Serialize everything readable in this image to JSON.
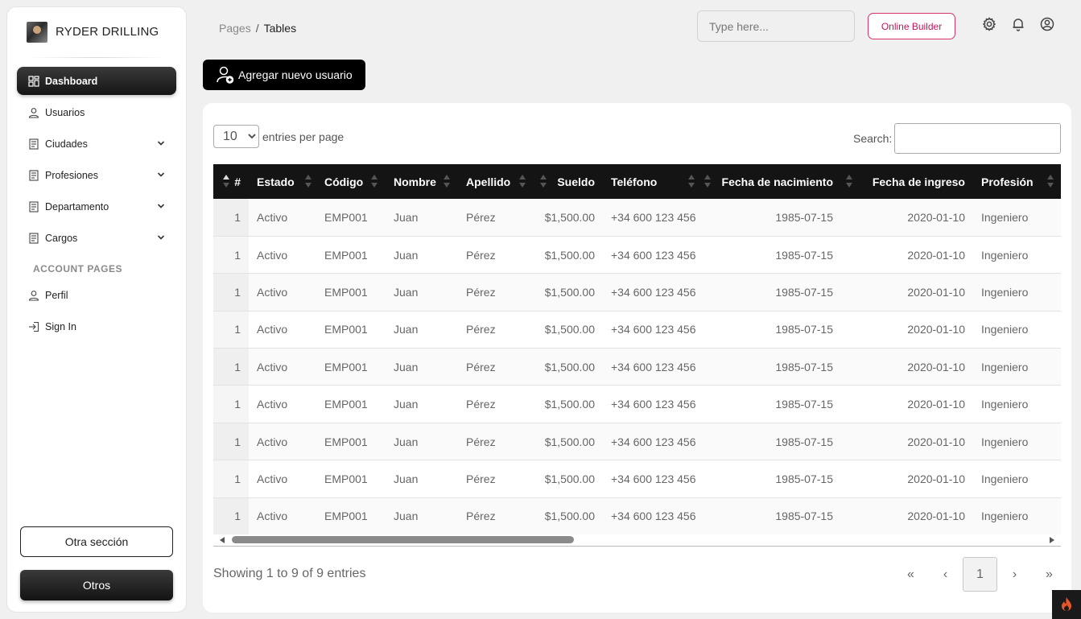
{
  "brand": {
    "name": "RYDER DRILLING"
  },
  "sidebar": {
    "items": [
      {
        "label": "Dashboard",
        "icon": "dashboard-icon",
        "active": true
      },
      {
        "label": "Usuarios",
        "icon": "user-icon"
      },
      {
        "label": "Ciudades",
        "icon": "document-icon",
        "expandable": true
      },
      {
        "label": "Profesiones",
        "icon": "document-icon",
        "expandable": true
      },
      {
        "label": "Departamento",
        "icon": "document-icon",
        "expandable": true
      },
      {
        "label": "Cargos",
        "icon": "document-icon",
        "expandable": true
      }
    ],
    "section_title": "ACCOUNT PAGES",
    "account_items": [
      {
        "label": "Perfil",
        "icon": "user-icon"
      },
      {
        "label": "Sign In",
        "icon": "sign-in-icon"
      }
    ],
    "buttons": {
      "otra_seccion": "Otra sección",
      "otros": "Otros"
    }
  },
  "header": {
    "breadcrumb": {
      "parent": "Pages",
      "separator": "/",
      "current": "Tables"
    },
    "search_placeholder": "Type here...",
    "builder_button": "Online Builder",
    "icons": [
      "gear-icon",
      "bell-icon",
      "account-circle-icon"
    ]
  },
  "add_user_button": "Agregar nuevo usuario",
  "table": {
    "page_size": "10",
    "page_size_options": [
      "10"
    ],
    "entries_label": "entries per page",
    "search_label": "Search:",
    "search_value": "",
    "columns": [
      "#",
      "Estado",
      "Código",
      "Nombre",
      "Apellido",
      "Sueldo",
      "Teléfono",
      "Fecha de nacimiento",
      "Fecha de ingreso",
      "Profesión"
    ],
    "rows": [
      [
        "1",
        "Activo",
        "EMP001",
        "Juan",
        "Pérez",
        "$1,500.00",
        "+34 600 123 456",
        "1985-07-15",
        "2020-01-10",
        "Ingeniero"
      ],
      [
        "1",
        "Activo",
        "EMP001",
        "Juan",
        "Pérez",
        "$1,500.00",
        "+34 600 123 456",
        "1985-07-15",
        "2020-01-10",
        "Ingeniero"
      ],
      [
        "1",
        "Activo",
        "EMP001",
        "Juan",
        "Pérez",
        "$1,500.00",
        "+34 600 123 456",
        "1985-07-15",
        "2020-01-10",
        "Ingeniero"
      ],
      [
        "1",
        "Activo",
        "EMP001",
        "Juan",
        "Pérez",
        "$1,500.00",
        "+34 600 123 456",
        "1985-07-15",
        "2020-01-10",
        "Ingeniero"
      ],
      [
        "1",
        "Activo",
        "EMP001",
        "Juan",
        "Pérez",
        "$1,500.00",
        "+34 600 123 456",
        "1985-07-15",
        "2020-01-10",
        "Ingeniero"
      ],
      [
        "1",
        "Activo",
        "EMP001",
        "Juan",
        "Pérez",
        "$1,500.00",
        "+34 600 123 456",
        "1985-07-15",
        "2020-01-10",
        "Ingeniero"
      ],
      [
        "1",
        "Activo",
        "EMP001",
        "Juan",
        "Pérez",
        "$1,500.00",
        "+34 600 123 456",
        "1985-07-15",
        "2020-01-10",
        "Ingeniero"
      ],
      [
        "1",
        "Activo",
        "EMP001",
        "Juan",
        "Pérez",
        "$1,500.00",
        "+34 600 123 456",
        "1985-07-15",
        "2020-01-10",
        "Ingeniero"
      ],
      [
        "1",
        "Activo",
        "EMP001",
        "Juan",
        "Pérez",
        "$1,500.00",
        "+34 600 123 456",
        "1985-07-15",
        "2020-01-10",
        "Ingeniero"
      ]
    ],
    "footer_info": "Showing 1 to 9 of 9 entries",
    "pagination": {
      "first": "«",
      "prev": "‹",
      "current": "1",
      "next": "›",
      "last": "»"
    }
  },
  "colors": {
    "accent": "#d6336c",
    "dark": "#141414"
  }
}
